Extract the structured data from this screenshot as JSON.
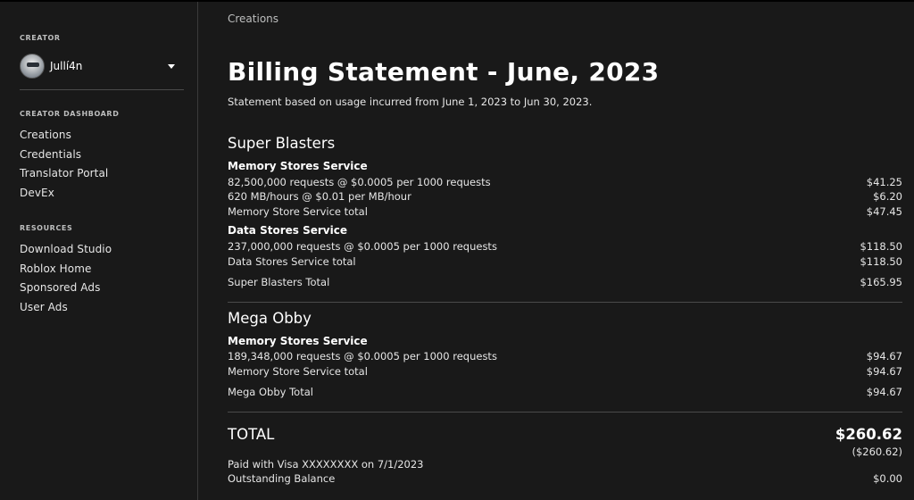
{
  "sidebar": {
    "creator_label": "CREATOR",
    "creator_name": "Jullí4n",
    "dashboard_label": "CREATOR DASHBOARD",
    "dashboard_items": [
      "Creations",
      "Credentials",
      "Translator Portal",
      "DevEx"
    ],
    "resources_label": "RESOURCES",
    "resources_items": [
      "Download Studio",
      "Roblox Home",
      "Sponsored Ads",
      "User Ads"
    ]
  },
  "main": {
    "breadcrumb": "Creations",
    "title": "Billing Statement - June, 2023",
    "subtitle": "Statement based on usage incurred from June 1, 2023 to Jun 30, 2023.",
    "games": [
      {
        "name": "Super Blasters",
        "services": [
          {
            "name": "Memory Stores Service",
            "lines": [
              {
                "label": "82,500,000 requests @ $0.0005 per 1000 requests",
                "amount": "$41.25"
              },
              {
                "label": "620 MB/hours @ $0.01 per MB/hour",
                "amount": "$6.20"
              },
              {
                "label": "Memory Store Service total",
                "amount": "$47.45"
              }
            ]
          },
          {
            "name": "Data Stores Service",
            "lines": [
              {
                "label": "237,000,000 requests @ $0.0005 per 1000 requests",
                "amount": "$118.50"
              },
              {
                "label": "Data Stores Service total",
                "amount": "$118.50"
              }
            ]
          }
        ],
        "total_label": "Super Blasters Total",
        "total_amount": "$165.95"
      },
      {
        "name": "Mega Obby",
        "services": [
          {
            "name": "Memory Stores Service",
            "lines": [
              {
                "label": "189,348,000 requests @ $0.0005 per 1000 requests",
                "amount": "$94.67"
              },
              {
                "label": "Memory Store Service total",
                "amount": "$94.67"
              }
            ]
          }
        ],
        "total_label": "Mega Obby Total",
        "total_amount": "$94.67"
      }
    ],
    "total_label": "TOTAL",
    "total_amount": "$260.62",
    "payment_amount": "($260.62)",
    "paid_label": "Paid with Visa XXXXXXXX on 7/1/2023",
    "outstanding_label": "Outstanding Balance",
    "outstanding_amount": "$0.00"
  }
}
